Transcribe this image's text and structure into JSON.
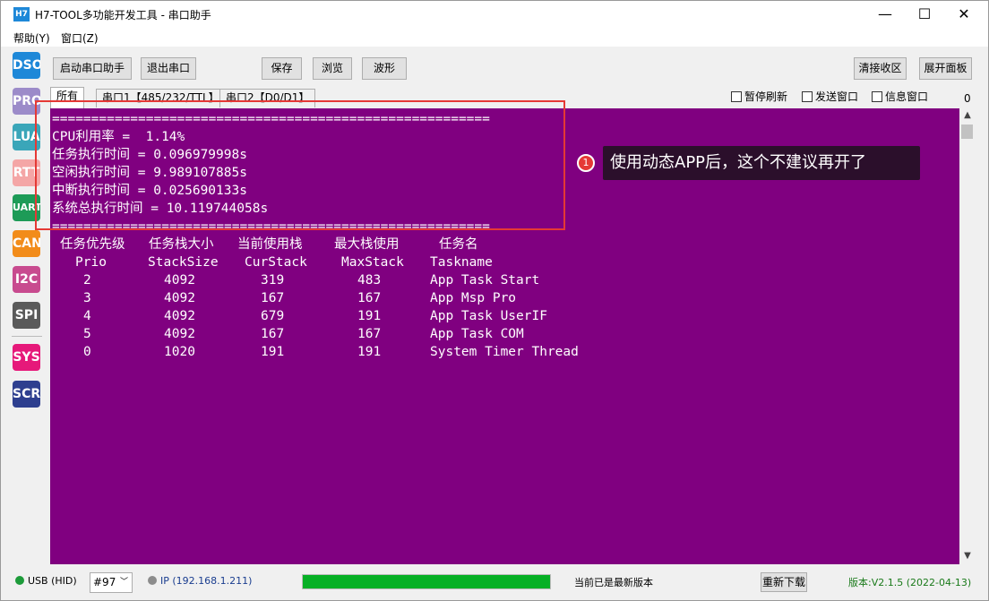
{
  "window": {
    "icon_text": "H7",
    "title": "H7-TOOL多功能开发工具 - 串口助手",
    "minimize": "—",
    "maximize": "☐",
    "close": "✕"
  },
  "menu": [
    "帮助(Y)",
    "窗口(Z)"
  ],
  "tools": [
    {
      "label": "DSO",
      "color": "#1e88d8"
    },
    {
      "label": "PRO",
      "color": "#9c8bc9"
    },
    {
      "label": "LUA",
      "color": "#3aa6b9"
    },
    {
      "label": "RTT",
      "color": "#f4a6a6"
    },
    {
      "label": "UART",
      "color": "#1d9b57"
    },
    {
      "label": "CAN",
      "color": "#f28c1a"
    },
    {
      "label": "I2C",
      "color": "#c84b8f"
    },
    {
      "label": "SPI",
      "color": "#5a5a5a"
    },
    {
      "label": "SYS",
      "color": "#e6197a"
    },
    {
      "label": "SCR",
      "color": "#2e3f8f"
    }
  ],
  "toolbar": {
    "start": "启动串口助手",
    "exit": "退出串口",
    "save": "保存",
    "browse": "浏览",
    "wave": "波形",
    "clear": "清接收区",
    "expand": "展开面板"
  },
  "tabs": [
    "所有",
    "串口1【485/232/TTL】",
    "串口2【D0/D1】"
  ],
  "checks": [
    "暂停刷新",
    "发送窗口",
    "信息窗口"
  ],
  "counter": "0",
  "terminal": {
    "separator": "========================================================",
    "cpu": "CPU利用率 =  1.14%",
    "task_time": "任务执行时间 = 0.096979998s",
    "idle_time": "空闲执行时间 = 9.989107885s",
    "isr_time": "中断执行时间 = 0.025690133s",
    "total_time": "系统总执行时间 = 10.119744058s",
    "headers_cn": [
      "任务优先级",
      "任务栈大小",
      "当前使用栈",
      "最大栈使用",
      "任务名"
    ],
    "headers_en": [
      "Prio",
      "StackSize",
      "CurStack",
      "MaxStack",
      "Taskname"
    ],
    "rows": [
      [
        "2",
        "4092",
        "319",
        "483",
        "App Task Start"
      ],
      [
        "3",
        "4092",
        "167",
        "167",
        "App Msp Pro"
      ],
      [
        "4",
        "4092",
        "679",
        "191",
        "App Task UserIF"
      ],
      [
        "5",
        "4092",
        "167",
        "167",
        "App Task COM"
      ],
      [
        "0",
        "1020",
        "191",
        "191",
        "System Timer Thread"
      ]
    ]
  },
  "callout": {
    "number": "1",
    "text": "使用动态APP后，这个不建议再开了"
  },
  "status": {
    "usb": "USB (HID)",
    "port": "#97",
    "ip": "IP (192.168.1.211)",
    "progress_pct": 100,
    "update_msg": "当前已是最新版本",
    "redownload": "重新下载",
    "version": "版本:V2.1.5 (2022-04-13)"
  }
}
